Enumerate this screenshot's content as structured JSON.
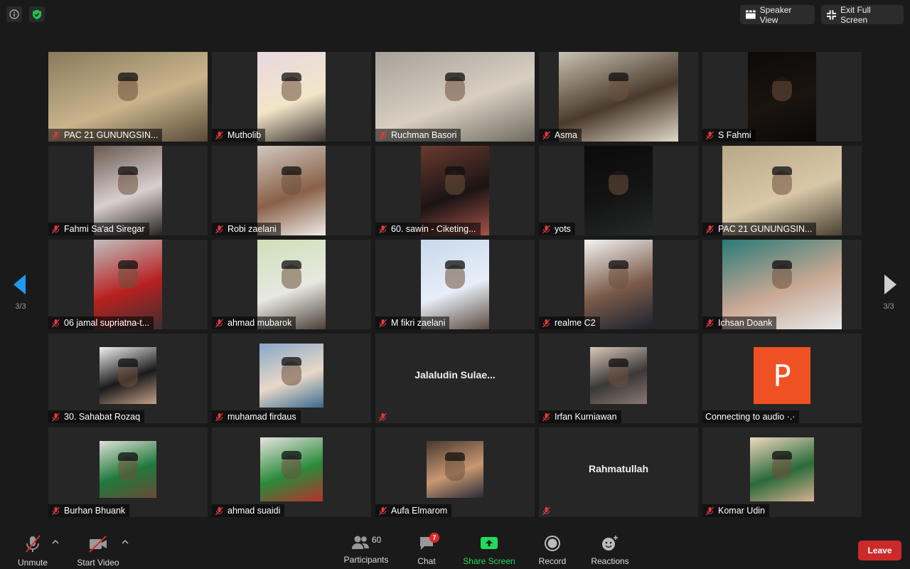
{
  "top": {
    "speaker_view_label": "Speaker View",
    "exit_full_screen_label": "Exit Full Screen"
  },
  "pagination": {
    "left_label": "3/3",
    "right_label": "3/3"
  },
  "participants": [
    {
      "name": "PAC 21 GUNUNGSIN...",
      "muted": true,
      "video": true,
      "colors": [
        "#8a7a5c",
        "#c9b48c",
        "#5a4a38"
      ]
    },
    {
      "name": "Mutholib",
      "muted": true,
      "video": true,
      "colors": [
        "#e8d7e0",
        "#f2e6c8",
        "#3a3230"
      ]
    },
    {
      "name": "Ruchman Basori",
      "muted": true,
      "video": true,
      "colors": [
        "#a8a098",
        "#d8cfc2",
        "#6f6a60"
      ]
    },
    {
      "name": "Asma",
      "muted": true,
      "video": true,
      "colors": [
        "#c9c2b2",
        "#4a3a2e",
        "#e0d8c8"
      ]
    },
    {
      "name": "S Fahmi",
      "muted": true,
      "video": true,
      "colors": [
        "#0d0a08",
        "#1a1410",
        "#0a0806"
      ]
    },
    {
      "name": "Fahmi Sa'ad Siregar",
      "muted": true,
      "video": true,
      "colors": [
        "#6a5a50",
        "#d8d0d0",
        "#2a2220"
      ]
    },
    {
      "name": "Robi zaelani",
      "muted": true,
      "video": true,
      "colors": [
        "#cfc8c0",
        "#8a6048",
        "#f0ece8"
      ]
    },
    {
      "name": "60. sawin -  Ciketing...",
      "muted": true,
      "video": true,
      "colors": [
        "#6b3a2e",
        "#1a1414",
        "#a8524a"
      ]
    },
    {
      "name": "yots",
      "muted": true,
      "video": true,
      "colors": [
        "#0a0a0a",
        "#141414",
        "#262a2a"
      ]
    },
    {
      "name": "PAC 21 GUNUNGSIN...",
      "muted": true,
      "video": true,
      "colors": [
        "#b8a888",
        "#d8c8a8",
        "#4a4234"
      ]
    },
    {
      "name": "06 jamal supriatna-t...",
      "muted": true,
      "video": true,
      "colors": [
        "#c0c0c0",
        "#b82020",
        "#3a3030"
      ]
    },
    {
      "name": "ahmad mubarok",
      "muted": true,
      "video": true,
      "colors": [
        "#cde0b8",
        "#e8e8e0",
        "#4a4038"
      ]
    },
    {
      "name": "M fikri zaelani",
      "muted": true,
      "video": true,
      "colors": [
        "#c8d8ec",
        "#e8eef8",
        "#5a4a40"
      ]
    },
    {
      "name": "realme C2",
      "muted": true,
      "video": true,
      "colors": [
        "#f4f4f4",
        "#7a5a48",
        "#1a2230"
      ]
    },
    {
      "name": "Ichsan Doank",
      "muted": true,
      "video": true,
      "colors": [
        "#2a7a78",
        "#c9a894",
        "#e8eaea"
      ]
    },
    {
      "name": "30. Sahabat Rozaq",
      "muted": true,
      "video": true,
      "colors": [
        "#f0f0f0",
        "#1a1a1a",
        "#c4a088"
      ]
    },
    {
      "name": "muhamad firdaus",
      "muted": true,
      "video": true,
      "colors": [
        "#88a8c8",
        "#e8d8c8",
        "#3a6a90"
      ]
    },
    {
      "name": "",
      "display_name": "Jalaludin  Sulae...",
      "muted": true,
      "video": false
    },
    {
      "name": "Irfan Kurniawan",
      "muted": true,
      "video": true,
      "colors": [
        "#d8c8b8",
        "#3a3838",
        "#8a7a70"
      ]
    },
    {
      "name": "Connecting to audio ·.·",
      "muted": false,
      "video": false,
      "avatar_letter": "P",
      "avatar_color": "#f05122"
    },
    {
      "name": "Burhan Bhuank",
      "muted": true,
      "video": true,
      "colors": [
        "#e0e0d8",
        "#1f7a3a",
        "#6a4a38"
      ]
    },
    {
      "name": "ahmad suaidi",
      "muted": true,
      "video": true,
      "colors": [
        "#e8e4e0",
        "#2a8a3a",
        "#b83030"
      ]
    },
    {
      "name": "Aufa Elmarom",
      "muted": true,
      "video": true,
      "colors": [
        "#4a3830",
        "#c89870",
        "#2a2a3a"
      ]
    },
    {
      "name": "",
      "display_name": "Rahmatullah",
      "muted": true,
      "video": false
    },
    {
      "name": "Komar Udin",
      "muted": true,
      "video": true,
      "colors": [
        "#f0d8c0",
        "#2a6a3a",
        "#d8b090"
      ]
    }
  ],
  "toolbar": {
    "unmute_label": "Unmute",
    "start_video_label": "Start Video",
    "participants_label": "Participants",
    "participants_count": "60",
    "chat_label": "Chat",
    "chat_badge": "7",
    "share_label": "Share Screen",
    "record_label": "Record",
    "reactions_label": "Reactions",
    "leave_label": "Leave",
    "share_color": "#23d959"
  }
}
